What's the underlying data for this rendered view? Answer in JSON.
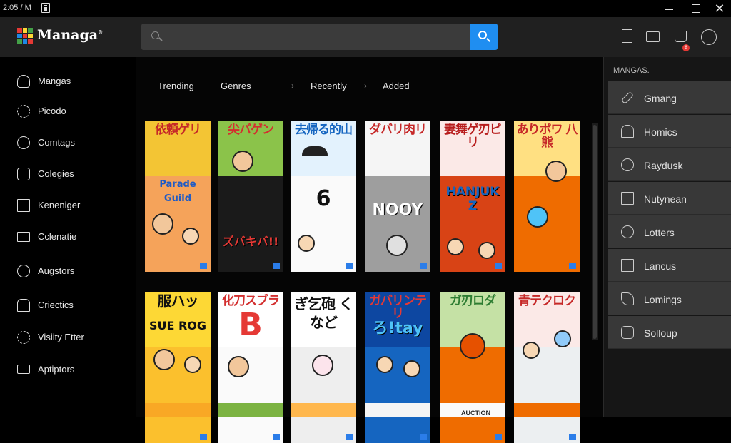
{
  "titlebar": {
    "time": "2:05 / M"
  },
  "header": {
    "app_name": "Managa",
    "app_mark": "®",
    "search_placeholder": "",
    "notification_count": "8"
  },
  "sidebar": {
    "items": [
      {
        "label": "Mangas",
        "icon": "user-icon"
      },
      {
        "label": "Picodo",
        "icon": "settings-icon"
      },
      {
        "label": "Comtags",
        "icon": "chat-icon"
      },
      {
        "label": "Colegies",
        "icon": "folder-icon"
      },
      {
        "label": "Keneniger",
        "icon": "list-icon"
      },
      {
        "label": "Cclenatie",
        "icon": "mail-icon"
      },
      {
        "label": "Augstors",
        "icon": "power-icon"
      },
      {
        "label": "Criectics",
        "icon": "home-icon"
      },
      {
        "label": "Visiity Etter",
        "icon": "gear-icon"
      },
      {
        "label": "Aptiptors",
        "icon": "keyboard-icon"
      }
    ]
  },
  "tabs": [
    {
      "label": "Trending"
    },
    {
      "label": "Genres"
    },
    {
      "label": "Recently"
    },
    {
      "label": "Added"
    }
  ],
  "tab_separators": [
    "›",
    "›"
  ],
  "row1": [
    {
      "title": "依頼ゲリ",
      "sub": "Parade Guild"
    },
    {
      "title": "尖バゲン",
      "sub": "ズバキバ!!"
    },
    {
      "title": "去帰る的山",
      "sub": "6"
    },
    {
      "title": "ダバリ肉リ",
      "sub": "NOOY"
    },
    {
      "title": "妻舞ゲ刃ビリ",
      "sub": "HANJUK Z"
    },
    {
      "title": "ありボワ 八熊",
      "sub": ""
    }
  ],
  "row2": [
    {
      "title": "服ハッ",
      "sub": "SUE ROG"
    },
    {
      "title": "化刀スブラ",
      "sub": "B"
    },
    {
      "title": "ぎ乞砲 くなど",
      "sub": ""
    },
    {
      "title": "ガバリンテリ",
      "sub": "ろ!tay"
    },
    {
      "title": "ガ刃ロダ",
      "sub": ""
    },
    {
      "title": "青テクロク",
      "sub": ""
    }
  ],
  "row3": [
    "",
    "",
    "",
    "",
    "AUCTION",
    ""
  ],
  "right_panel": {
    "title": "MANGAS.",
    "items": [
      {
        "label": "Gmang",
        "icon": "pen-icon"
      },
      {
        "label": "Homics",
        "icon": "building-icon"
      },
      {
        "label": "Raydusk",
        "icon": "users-icon"
      },
      {
        "label": "Nutynean",
        "icon": "document-icon"
      },
      {
        "label": "Lotters",
        "icon": "target-icon"
      },
      {
        "label": "Lancus",
        "icon": "clipboard-icon"
      },
      {
        "label": "Lomings",
        "icon": "star-icon"
      },
      {
        "label": "Solloup",
        "icon": "file-icon"
      }
    ]
  },
  "colors": {
    "accent": "#1f8ef1",
    "header_bg": "#202020",
    "panel_item_bg": "#383838"
  }
}
